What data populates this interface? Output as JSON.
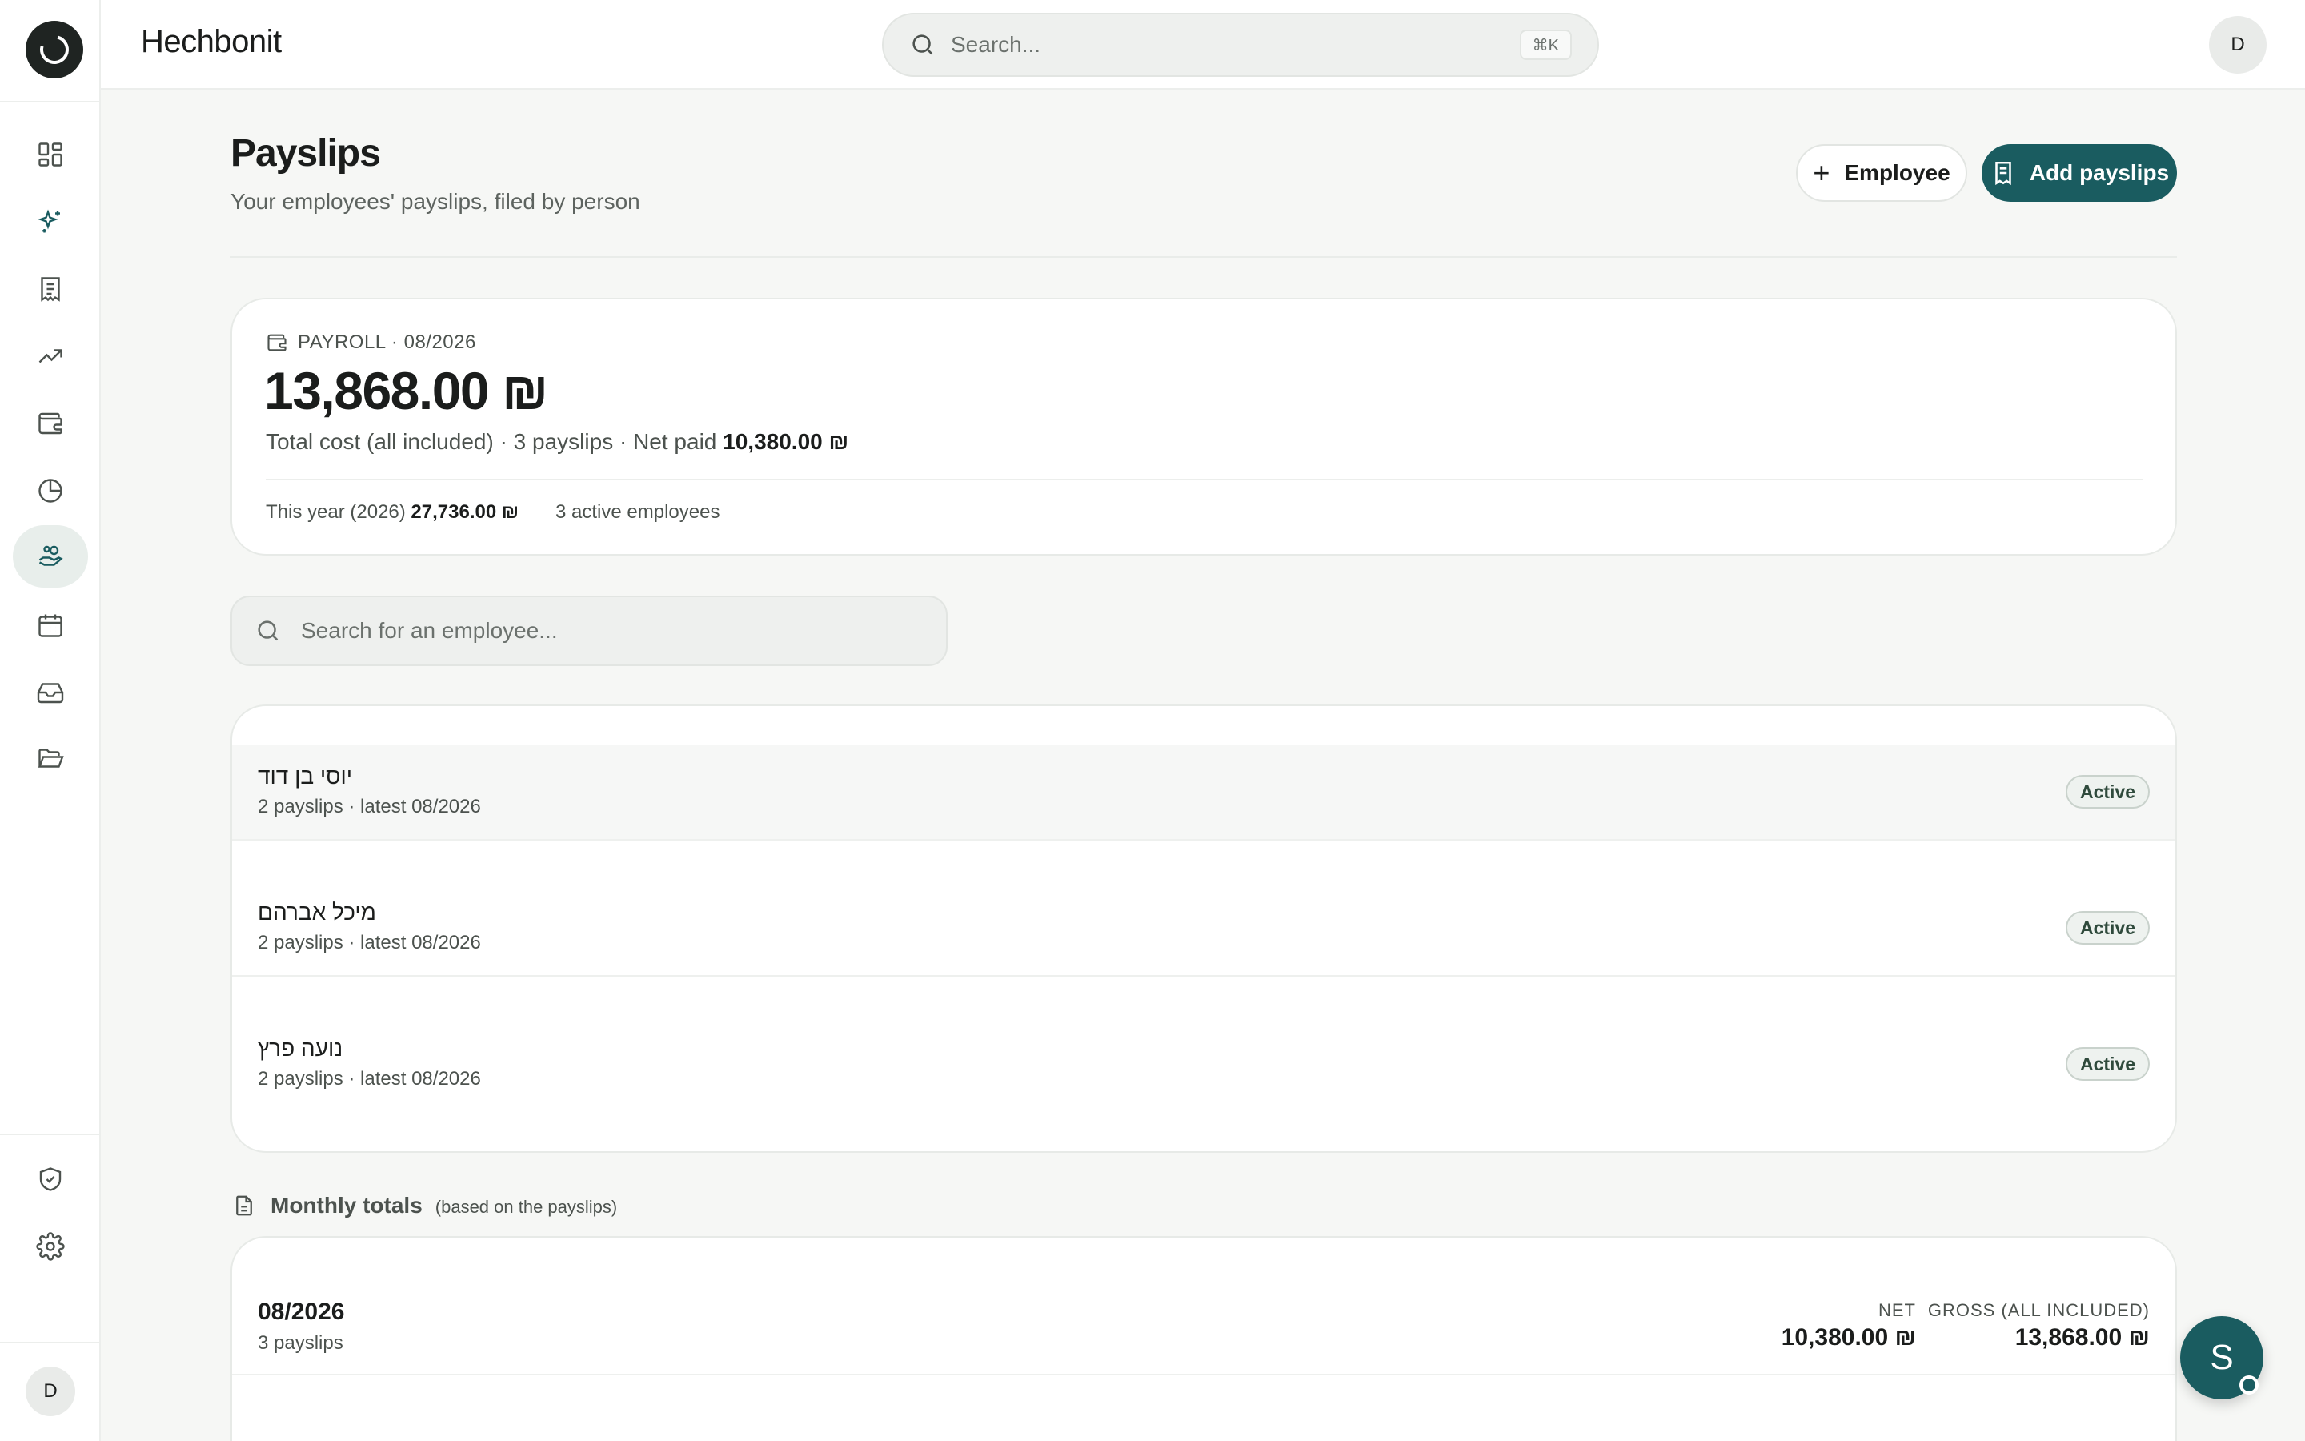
{
  "app": {
    "title": "Hechbonit"
  },
  "search": {
    "placeholder": "Search...",
    "shortcut": "⌘K"
  },
  "user": {
    "initial": "D"
  },
  "sidebar": {
    "items": [
      {
        "name": "dashboard",
        "icon": "grid-icon"
      },
      {
        "name": "assistant",
        "icon": "sparkles-icon"
      },
      {
        "name": "documents",
        "icon": "receipt-icon"
      },
      {
        "name": "reports",
        "icon": "trending-up-icon"
      },
      {
        "name": "wallet",
        "icon": "wallet-icon"
      },
      {
        "name": "analytics",
        "icon": "pie-chart-icon"
      },
      {
        "name": "payslips",
        "icon": "hand-coins-icon",
        "active": true
      },
      {
        "name": "calendar",
        "icon": "calendar-icon"
      },
      {
        "name": "inbox",
        "icon": "inbox-icon"
      },
      {
        "name": "files",
        "icon": "folder-open-icon"
      }
    ],
    "bottom": [
      {
        "name": "security",
        "icon": "shield-check-icon"
      },
      {
        "name": "settings",
        "icon": "gear-icon"
      }
    ],
    "avatar": "D"
  },
  "header": {
    "title": "Payslips",
    "subtitle": "Your employees' payslips, filed by person",
    "employee_button": "Employee",
    "add_button": "Add payslips"
  },
  "payroll": {
    "label": "PAYROLL · 08/2026",
    "amount": "13,868.00 ₪",
    "meta_prefix": "Total cost (all included) · 3 payslips · Net paid ",
    "net_paid": "10,380.00 ₪",
    "year_label": "This year (2026) ",
    "year_value": "27,736.00 ₪",
    "active_employees": "3 active employees"
  },
  "employee_search": {
    "placeholder": "Search for an employee..."
  },
  "employees": [
    {
      "name": "יוסי בן דוד",
      "meta": "2 payslips · latest 08/2026",
      "status": "Active"
    },
    {
      "name": "מיכל אברהם",
      "meta": "2 payslips · latest 08/2026",
      "status": "Active"
    },
    {
      "name": "נועה פרץ",
      "meta": "2 payslips · latest 08/2026",
      "status": "Active"
    }
  ],
  "monthly_totals": {
    "title": "Monthly totals",
    "note": "(based on the payslips)",
    "rows": [
      {
        "month": "08/2026",
        "count": "3 payslips",
        "net_label": "NET",
        "net": "10,380.00 ₪",
        "gross_label": "GROSS (ALL INCLUDED)",
        "gross": "13,868.00 ₪"
      }
    ]
  },
  "assistant": {
    "initial": "S"
  },
  "colors": {
    "accent": "#1a5c60",
    "background": "#f6f7f5",
    "badge_border": "#c9d2cc"
  }
}
